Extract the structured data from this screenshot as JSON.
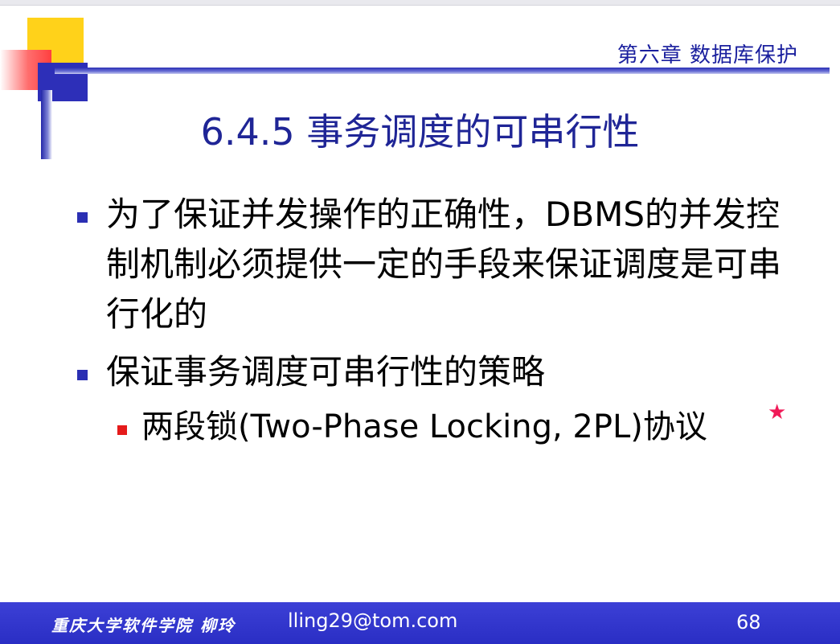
{
  "header": {
    "chapter": "第六章 数据库保护"
  },
  "slide": {
    "title": "6.4.5 事务调度的可串行性",
    "bullets": [
      "为了保证并发操作的正确性，DBMS的并发控制机制必须提供一定的手段来保证调度是可串行化的",
      "保证事务调度可串行性的策略"
    ],
    "sub_bullets": [
      "两段锁(Two-Phase Locking, 2PL)协议"
    ],
    "star": "★"
  },
  "footer": {
    "school": "重庆大学软件学院  柳玲",
    "email": "lling29@tom.com",
    "page": "68"
  },
  "colors": {
    "accent": "#1f2596",
    "footer_bg": "#2a2ec4",
    "sub_marker": "#e51b1b",
    "star": "#f01a58"
  }
}
